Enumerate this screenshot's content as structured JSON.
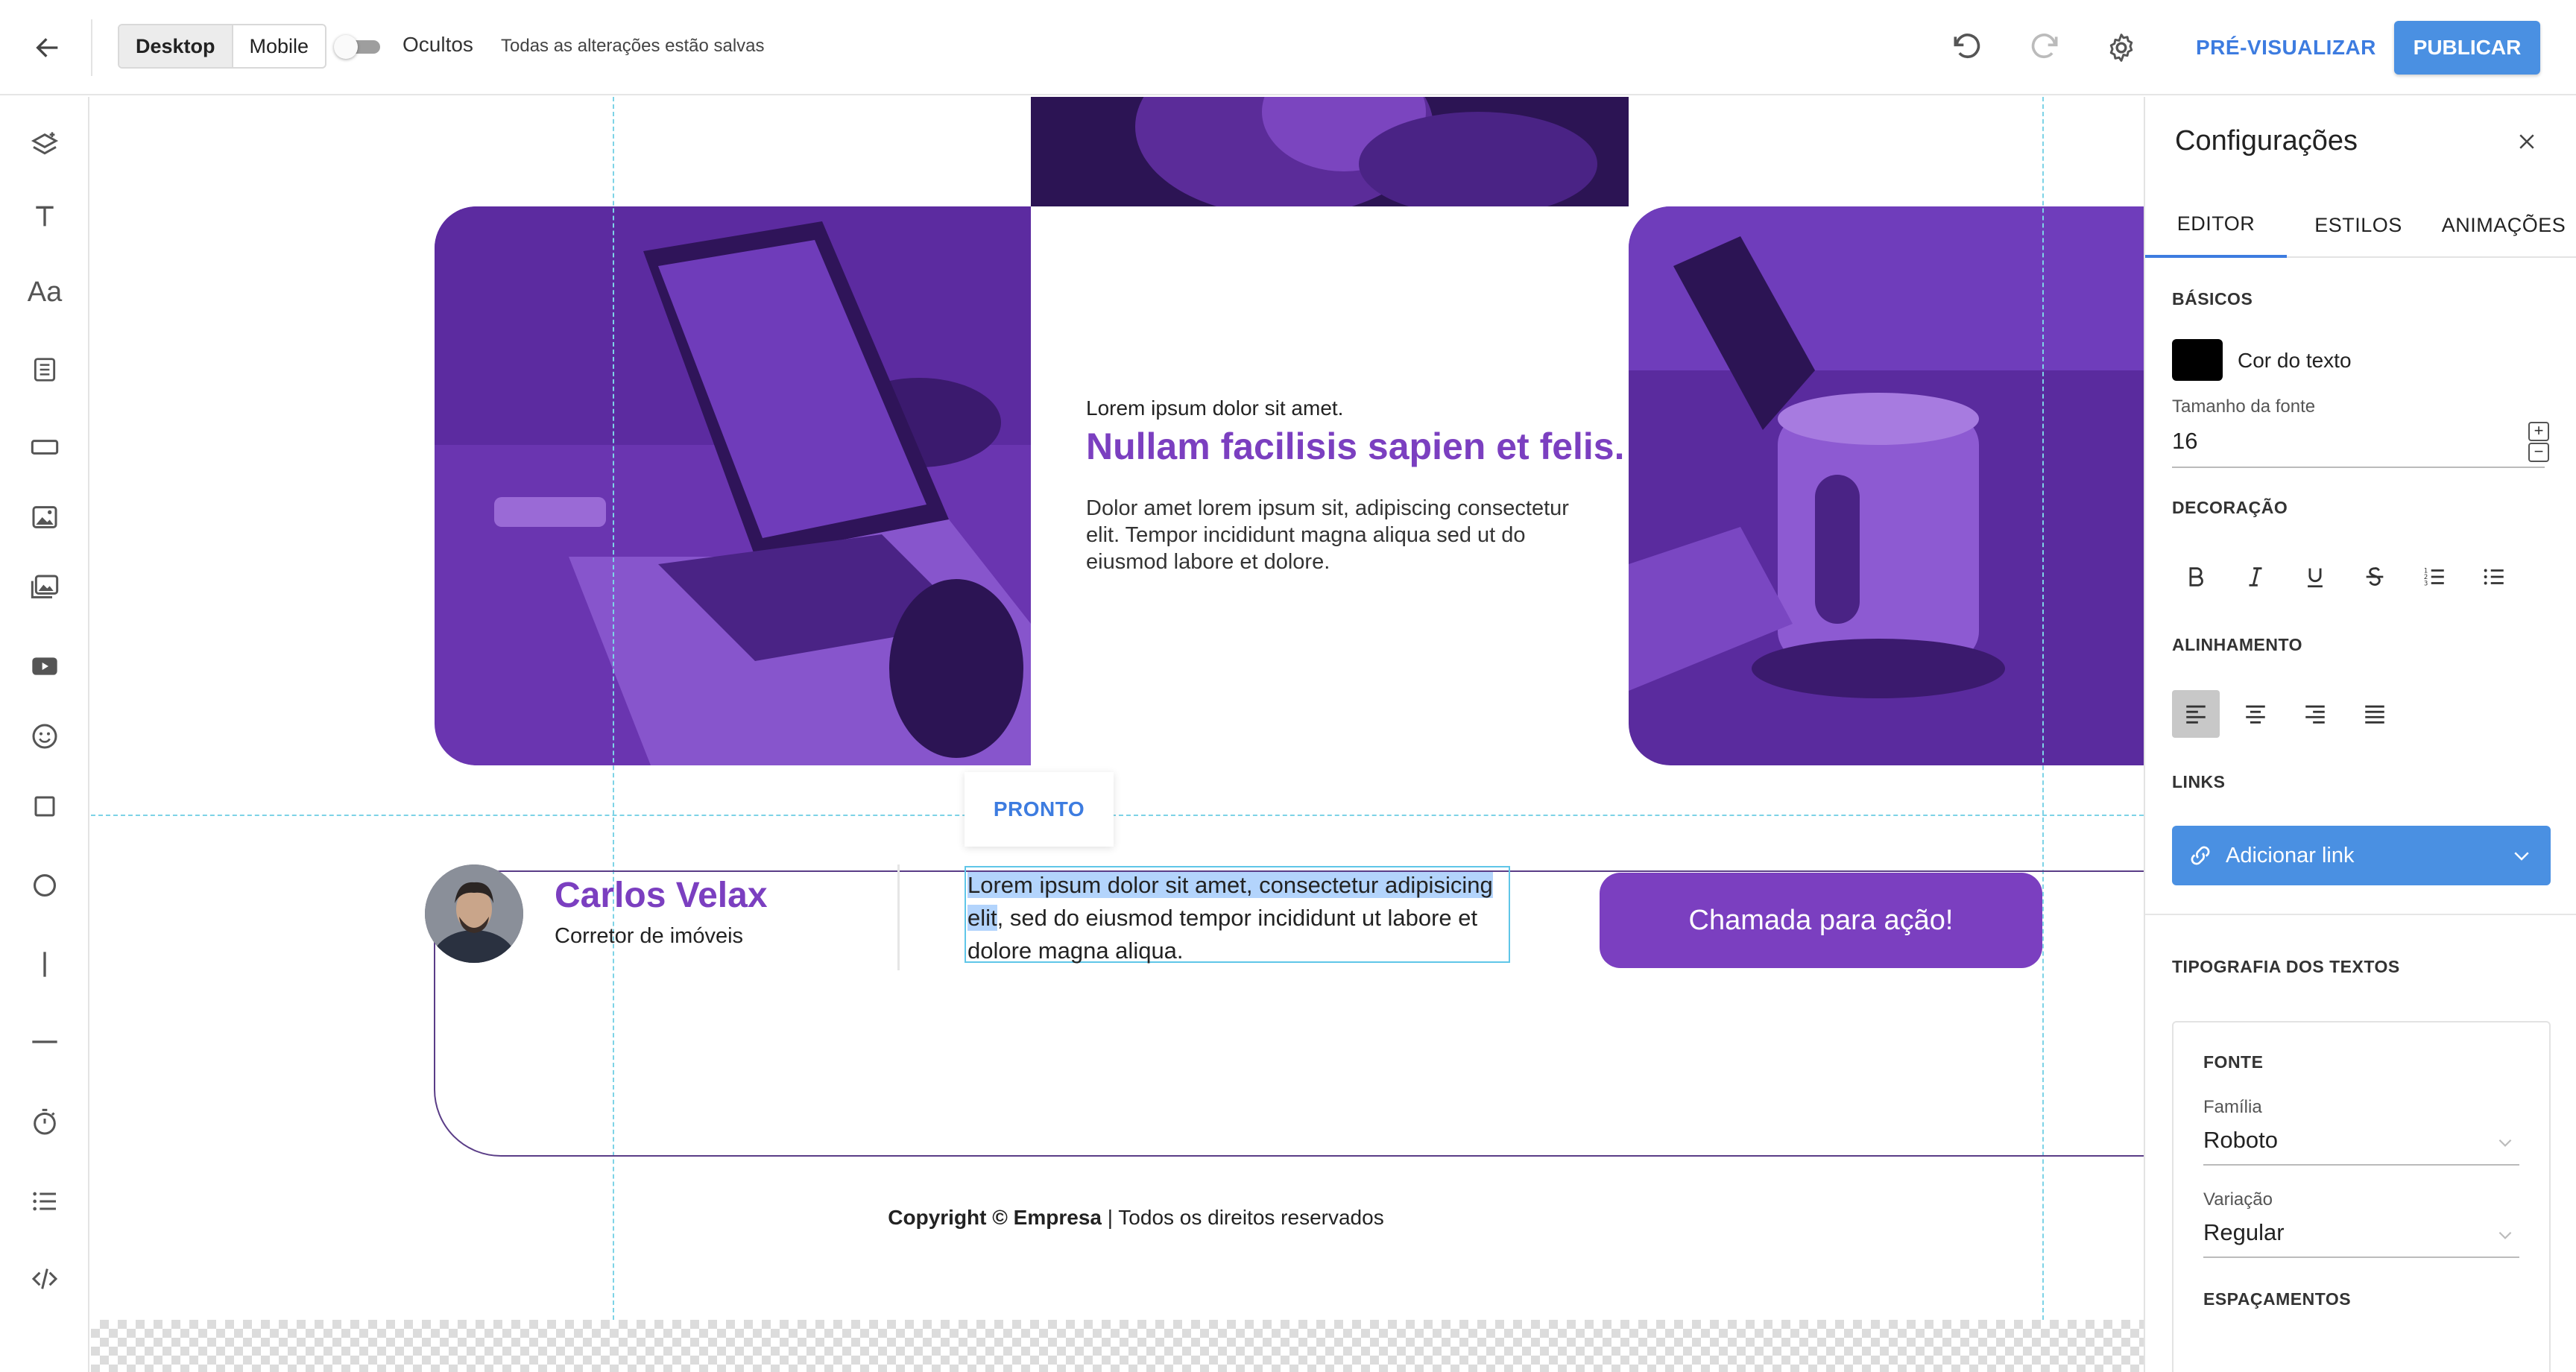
{
  "topbar": {
    "device_desktop": "Desktop",
    "device_mobile": "Mobile",
    "hidden_label": "Ocultos",
    "saved_status": "Todas as alterações estão salvas",
    "preview_label": "PRÉ-VISUALIZAR",
    "publish_label": "PUBLICAR"
  },
  "left_tools": [
    "layers-icon",
    "text-icon",
    "typography-icon",
    "form-icon",
    "button-icon",
    "image-icon",
    "gallery-icon",
    "video-icon",
    "emoji-icon",
    "square-icon",
    "circle-icon",
    "vertical-line-icon",
    "horizontal-line-icon",
    "timer-icon",
    "list-icon",
    "code-icon"
  ],
  "canvas": {
    "feature": {
      "small": "Lorem ipsum dolor sit amet.",
      "title": "Nullam facilisis sapien et felis.",
      "body": "Dolor amet lorem ipsum sit, adipiscing consectetur elit. Tempor incididunt magna aliqua sed ut do eiusmod labore et dolore."
    },
    "agent": {
      "status_tag": "PRONTO",
      "name": "Carlos Velax",
      "role": "Corretor de imóveis",
      "text_selected": "Lorem ipsum dolor sit amet, consectetur adipisicing elit",
      "text_rest": ", sed do eiusmod tempor incididunt ut labore et dolore magna aliqua.",
      "cta_label": "Chamada para ação!"
    },
    "footer": {
      "copyright_bold": "Copyright © Empresa",
      "copyright_rest": " | Todos os direitos reservados"
    }
  },
  "panel": {
    "title": "Configurações",
    "tabs": [
      "EDITOR",
      "ESTILOS",
      "ANIMAÇÕES"
    ],
    "active_tab": "EDITOR",
    "basics_label": "BÁSICOS",
    "text_color_label": "Cor do texto",
    "text_color": "#000000",
    "font_size_label": "Tamanho da fonte",
    "font_size_value": "16",
    "decoration_label": "DECORAÇÃO",
    "alignment_label": "ALINHAMENTO",
    "active_alignment": "left",
    "links_label": "LINKS",
    "add_link_label": "Adicionar link",
    "typography_label": "TIPOGRAFIA DOS TEXTOS",
    "font_label": "FONTE",
    "family_label": "Família",
    "family_value": "Roboto",
    "variation_label": "Variação",
    "variation_value": "Regular",
    "spacing_label": "ESPAÇAMENTOS"
  },
  "colors": {
    "accent_purple": "#7b3fc0",
    "primary_blue": "#4a90e2",
    "guide_cyan": "#7dd3e6"
  }
}
